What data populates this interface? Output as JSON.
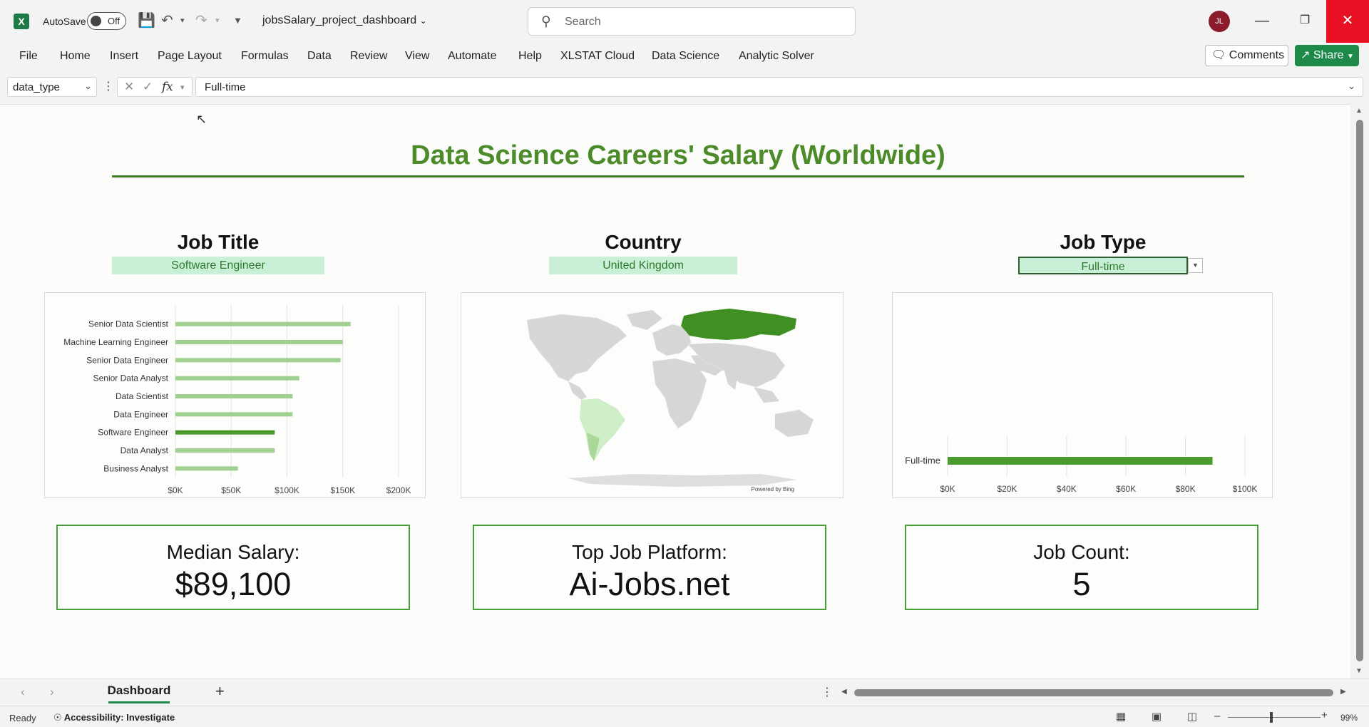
{
  "app": {
    "autosave_label": "AutoSave",
    "autosave_state": "Off",
    "doc_title": "jobsSalary_project_dashboard",
    "search_placeholder": "Search",
    "user_initials": "JL"
  },
  "ribbon": {
    "tabs": [
      "File",
      "Home",
      "Insert",
      "Page Layout",
      "Formulas",
      "Data",
      "Review",
      "View",
      "Automate",
      "Help",
      "XLSTAT Cloud",
      "Data Science",
      "Analytic Solver"
    ],
    "comments_label": "Comments",
    "share_label": "Share"
  },
  "formula_bar": {
    "name_box": "data_type",
    "fx": "fx",
    "formula": "Full-time"
  },
  "dashboard": {
    "title": "Data Science Careers' Salary (Worldwide)",
    "sections": {
      "job_title": {
        "heading": "Job Title",
        "selected": "Software Engineer"
      },
      "country": {
        "heading": "Country",
        "selected": "United Kingdom"
      },
      "job_type": {
        "heading": "Job Type",
        "selected": "Full-time"
      }
    },
    "map_credit": "Powered by Bing",
    "kpis": [
      {
        "label": "Median Salary:",
        "value": "$89,100"
      },
      {
        "label": "Top Job Platform:",
        "value": "Ai-Jobs.net"
      },
      {
        "label": "Job Count:",
        "value": "5"
      }
    ],
    "highlight_color": "#4a9a2e",
    "muted_color": "#9fd08f"
  },
  "chart_data": [
    {
      "type": "bar",
      "orientation": "horizontal",
      "categories": [
        "Senior Data Scientist",
        "Machine Learning Engineer",
        "Senior Data Engineer",
        "Senior Data Analyst",
        "Data Scientist",
        "Data Engineer",
        "Software Engineer",
        "Data Analyst",
        "Business Analyst"
      ],
      "values": [
        157000,
        150000,
        148000,
        111000,
        105000,
        105000,
        89000,
        89000,
        56000
      ],
      "highlight": "Software Engineer",
      "xlim": [
        0,
        200000
      ],
      "xticks": [
        "$0K",
        "$50K",
        "$100K",
        "$150K",
        "$200K"
      ],
      "grid": true
    },
    {
      "type": "bar",
      "orientation": "horizontal",
      "categories": [
        "Full-time"
      ],
      "values": [
        89100
      ],
      "xlim": [
        0,
        100000
      ],
      "xticks": [
        "$0K",
        "$20K",
        "$40K",
        "$60K",
        "$80K",
        "$100K"
      ],
      "grid": true
    }
  ],
  "sheet_tabs": {
    "active": "Dashboard",
    "add": "+"
  },
  "status": {
    "ready": "Ready",
    "accessibility": "Accessibility: Investigate",
    "zoom": "99%"
  }
}
